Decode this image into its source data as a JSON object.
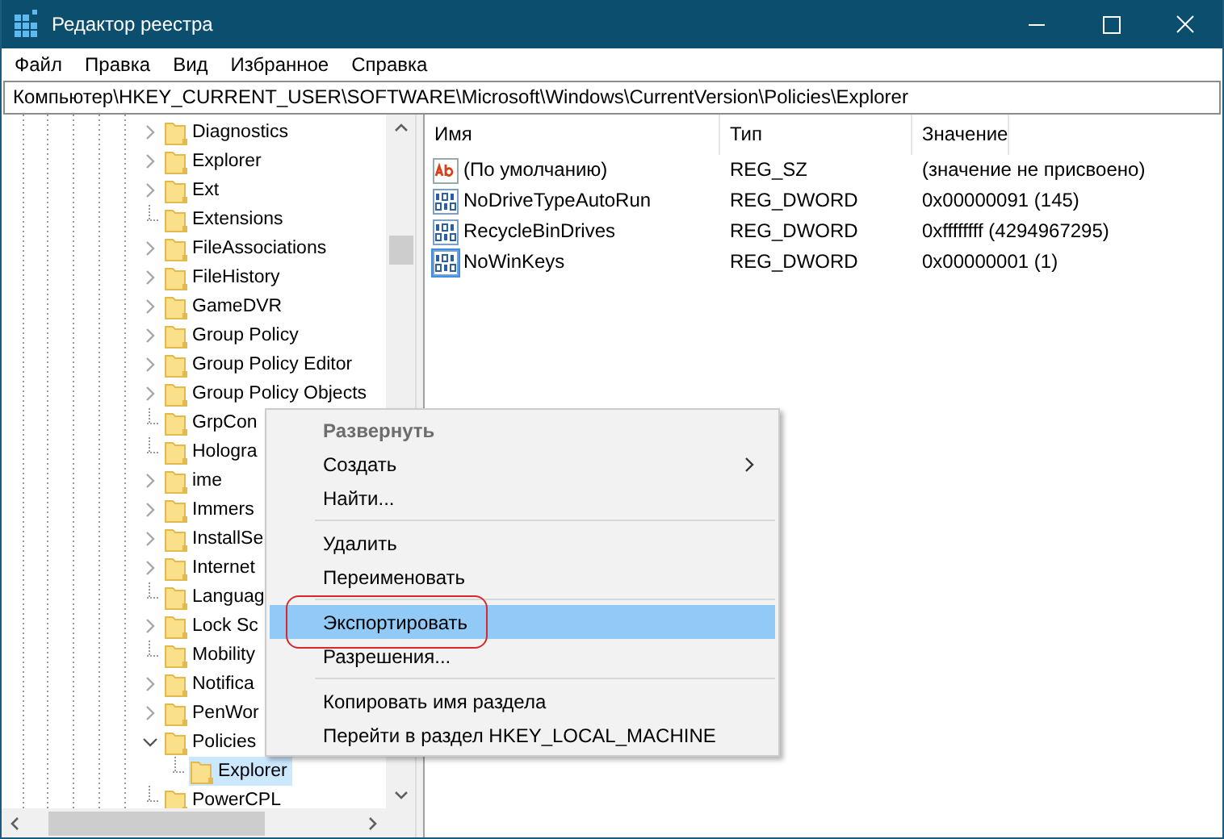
{
  "window": {
    "title": "Редактор реестра"
  },
  "menu_bar": [
    "Файл",
    "Правка",
    "Вид",
    "Избранное",
    "Справка"
  ],
  "address": "Компьютер\\HKEY_CURRENT_USER\\SOFTWARE\\Microsoft\\Windows\\CurrentVersion\\Policies\\Explorer",
  "tree": [
    {
      "kind": "branch",
      "label": "Diagnostics",
      "expanded": false,
      "selected": false
    },
    {
      "kind": "branch",
      "label": "Explorer",
      "expanded": false,
      "selected": false
    },
    {
      "kind": "branch",
      "label": "Ext",
      "expanded": false,
      "selected": false
    },
    {
      "kind": "leaf",
      "label": "Extensions",
      "selected": false
    },
    {
      "kind": "branch",
      "label": "FileAssociations",
      "expanded": false,
      "selected": false
    },
    {
      "kind": "branch",
      "label": "FileHistory",
      "expanded": false,
      "selected": false
    },
    {
      "kind": "branch",
      "label": "GameDVR",
      "expanded": false,
      "selected": false
    },
    {
      "kind": "branch",
      "label": "Group Policy",
      "expanded": false,
      "selected": false
    },
    {
      "kind": "branch",
      "label": "Group Policy Editor",
      "expanded": false,
      "selected": false
    },
    {
      "kind": "branch",
      "label": "Group Policy Objects",
      "expanded": false,
      "selected": false
    },
    {
      "kind": "leaf",
      "label": "GrpCon",
      "selected": false
    },
    {
      "kind": "leaf",
      "label": "Hologra",
      "selected": false
    },
    {
      "kind": "branch",
      "label": "ime",
      "expanded": false,
      "selected": false
    },
    {
      "kind": "branch",
      "label": "Immers",
      "expanded": false,
      "selected": false
    },
    {
      "kind": "branch",
      "label": "InstallSe",
      "expanded": false,
      "selected": false
    },
    {
      "kind": "branch",
      "label": "Internet",
      "expanded": false,
      "selected": false
    },
    {
      "kind": "leaf",
      "label": "Languag",
      "selected": false
    },
    {
      "kind": "branch",
      "label": "Lock Sc",
      "expanded": false,
      "selected": false
    },
    {
      "kind": "leaf",
      "label": "Mobility",
      "selected": false
    },
    {
      "kind": "branch",
      "label": "Notifica",
      "expanded": false,
      "selected": false
    },
    {
      "kind": "branch",
      "label": "PenWor",
      "expanded": false,
      "selected": false
    },
    {
      "kind": "branch",
      "label": "Policies",
      "expanded": true,
      "selected": false,
      "children": [
        {
          "kind": "leaf",
          "label": "Explorer",
          "selected": true
        }
      ]
    },
    {
      "kind": "leaf",
      "label": "PowerCPL",
      "selected": false
    }
  ],
  "table": {
    "columns": [
      "Имя",
      "Тип",
      "Значение"
    ],
    "rows": [
      {
        "kind": "string",
        "name": "(По умолчанию)",
        "type": "REG_SZ",
        "value": "(значение не присвоено)",
        "selected": false
      },
      {
        "kind": "dword",
        "name": "NoDriveTypeAutoRun",
        "type": "REG_DWORD",
        "value": "0x00000091 (145)",
        "selected": false
      },
      {
        "kind": "dword",
        "name": "RecycleBinDrives",
        "type": "REG_DWORD",
        "value": "0xffffffff (4294967295)",
        "selected": false
      },
      {
        "kind": "dword",
        "name": "NoWinKeys",
        "type": "REG_DWORD",
        "value": "0x00000001 (1)",
        "selected": true
      }
    ]
  },
  "context_menu": [
    {
      "kind": "item",
      "label": "Развернуть",
      "bold": true,
      "disabled": true,
      "submenu": false,
      "selected": false
    },
    {
      "kind": "item",
      "label": "Создать",
      "bold": false,
      "disabled": false,
      "submenu": true,
      "selected": false
    },
    {
      "kind": "item",
      "label": "Найти...",
      "bold": false,
      "disabled": false,
      "submenu": false,
      "selected": false
    },
    {
      "kind": "separator"
    },
    {
      "kind": "item",
      "label": "Удалить",
      "bold": false,
      "disabled": false,
      "submenu": false,
      "selected": false
    },
    {
      "kind": "item",
      "label": "Переименовать",
      "bold": false,
      "disabled": false,
      "submenu": false,
      "selected": false
    },
    {
      "kind": "separator"
    },
    {
      "kind": "item",
      "label": "Экспортировать",
      "bold": false,
      "disabled": false,
      "submenu": false,
      "selected": true,
      "circled": true
    },
    {
      "kind": "item",
      "label": "Разрешения...",
      "bold": false,
      "disabled": false,
      "submenu": false,
      "selected": false
    },
    {
      "kind": "separator"
    },
    {
      "kind": "item",
      "label": "Копировать имя раздела",
      "bold": false,
      "disabled": false,
      "submenu": false,
      "selected": false
    },
    {
      "kind": "item",
      "label": "Перейти в раздел HKEY_LOCAL_MACHINE",
      "bold": false,
      "disabled": false,
      "submenu": false,
      "selected": false
    }
  ]
}
